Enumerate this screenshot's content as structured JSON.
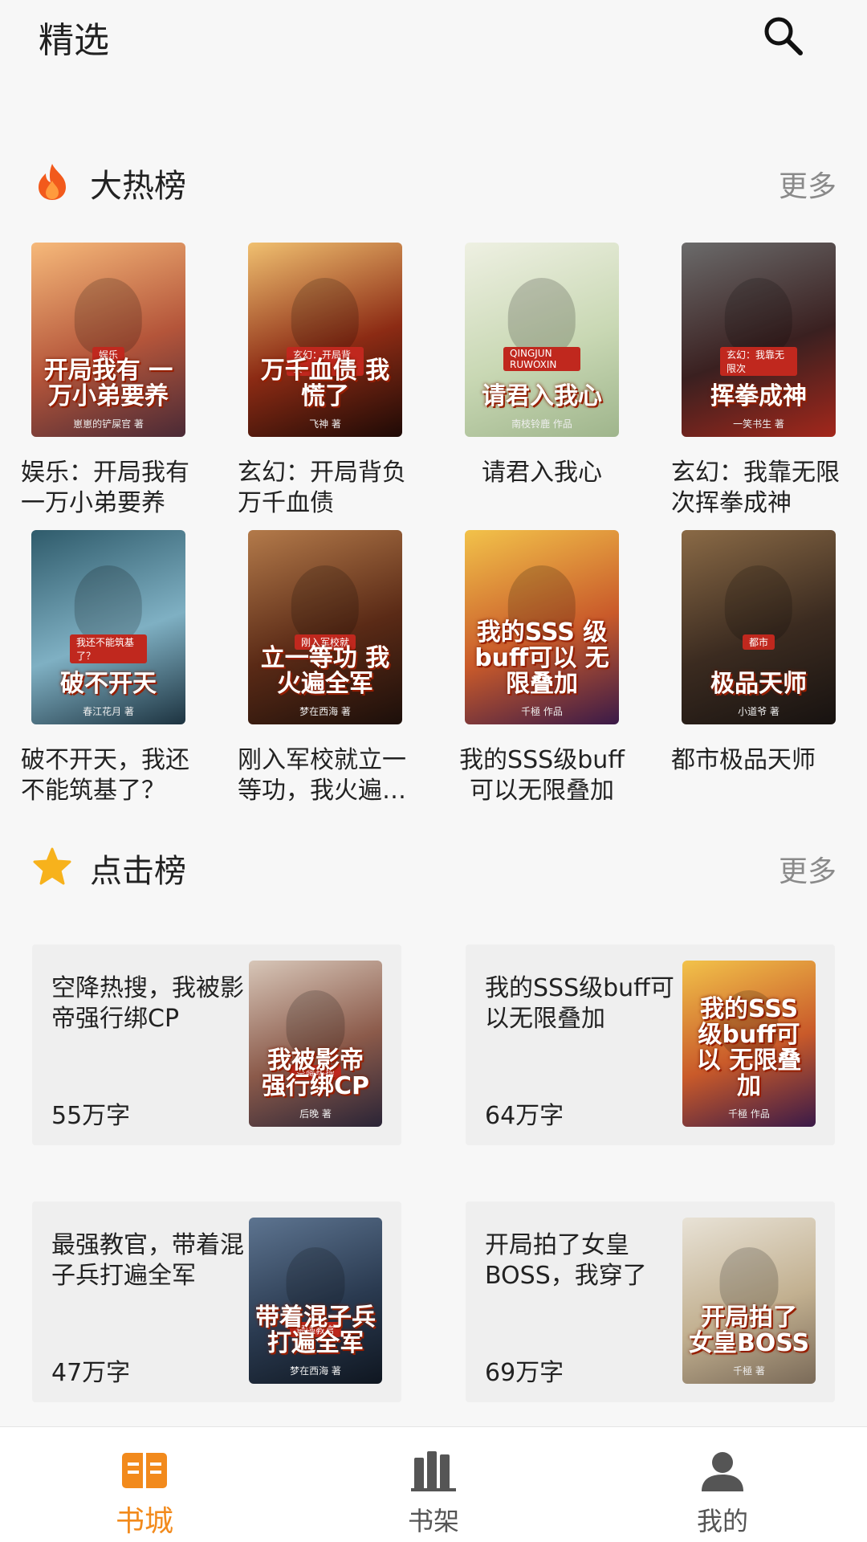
{
  "header": {
    "title": "精选",
    "search_icon": "search-icon"
  },
  "hot": {
    "title": "大热榜",
    "more": "更多",
    "icon": "flame-icon",
    "books": [
      {
        "title": "娱乐：开局我有一万小弟要养",
        "cover_text": "开局我有 一万小弟要养",
        "cover_tag": "娱乐",
        "cover_author": "崽崽的铲屎官 著",
        "colors": [
          "#f6b97a",
          "#b4553a",
          "#4a2a36"
        ]
      },
      {
        "title": "玄幻：开局背负万千血债",
        "cover_text": "万千血债 我慌了",
        "cover_tag": "玄幻：开局背负",
        "cover_author": "飞神 著",
        "colors": [
          "#f0c070",
          "#8c2b14",
          "#1e0a06"
        ]
      },
      {
        "title": "请君入我心",
        "cover_text": "请君入我心",
        "cover_tag": "QINGJUN RUWOXIN",
        "cover_author": "南枝铃鹿 作品",
        "colors": [
          "#eef0e2",
          "#c9d8b4",
          "#9fb58c"
        ]
      },
      {
        "title": "玄幻：我靠无限次挥拳成神",
        "cover_text": "挥拳成神",
        "cover_tag": "玄幻：我靠无限次",
        "cover_author": "一笑书生 著",
        "colors": [
          "#6b6b6b",
          "#3a2020",
          "#a3271b"
        ]
      },
      {
        "title": "破不开天，我还不能筑基了？",
        "cover_text": "破不开天",
        "cover_tag": "我还不能筑基了？",
        "cover_author": "春江花月 著",
        "colors": [
          "#2f5b6b",
          "#7fb0c3",
          "#1d3340"
        ]
      },
      {
        "title": "刚入军校就立一等功，我火遍全军",
        "cover_text": "立一等功 我火遍全军",
        "cover_tag": "刚入军校就",
        "cover_author": "梦在西海 著",
        "colors": [
          "#b37a4a",
          "#5a2a16",
          "#1c0f0a"
        ]
      },
      {
        "title": "我的SSS级buff可以无限叠加",
        "cover_text": "我的SSS 级buff可以 无限叠加",
        "cover_tag": "",
        "cover_author": "千極 作品",
        "colors": [
          "#f2c24a",
          "#c95a2a",
          "#3a1a48"
        ]
      },
      {
        "title": "都市极品天师",
        "cover_text": "极品天师",
        "cover_tag": "都市",
        "cover_author": "小道爷 著",
        "colors": [
          "#8a6a46",
          "#3b2b20",
          "#171210"
        ]
      }
    ]
  },
  "click": {
    "title": "点击榜",
    "more": "更多",
    "icon": "star-icon",
    "books": [
      {
        "title": "空降热搜，我被影帝强行绑CP",
        "count": "55万字",
        "cover_text": "我被影帝 强行绑CP",
        "cover_tag": "空降热搜",
        "cover_author": "后晚 著",
        "colors": [
          "#d7c6b8",
          "#8b5a4a",
          "#2a2436"
        ]
      },
      {
        "title": "我的SSS级buff可以无限叠加",
        "count": "64万字",
        "cover_text": "我的SSS 级buff可以 无限叠加",
        "cover_tag": "",
        "cover_author": "千極 作品",
        "colors": [
          "#f2c24a",
          "#c95a2a",
          "#3a1a48"
        ]
      },
      {
        "title": "最强教官，带着混子兵打遍全军",
        "count": "47万字",
        "cover_text": "带着混子兵 打遍全军",
        "cover_tag": "最强教官",
        "cover_author": "梦在西海 著",
        "colors": [
          "#5d7490",
          "#2a3a50",
          "#0f1620"
        ]
      },
      {
        "title": "开局拍了女皇BOSS，我穿了",
        "count": "69万字",
        "cover_text": "开局拍了 女皇BOSS",
        "cover_tag": "",
        "cover_author": "千極 著",
        "colors": [
          "#e8e2d6",
          "#c2b090",
          "#7a6a58"
        ]
      }
    ]
  },
  "nav": [
    {
      "label": "书城",
      "icon": "open-book-icon",
      "active": true
    },
    {
      "label": "书架",
      "icon": "bookshelf-icon",
      "active": false
    },
    {
      "label": "我的",
      "icon": "user-icon",
      "active": false
    }
  ],
  "colors": {
    "accent": "#f28a1c",
    "flame": "#f25a1c",
    "star": "#f7b21c",
    "muted": "#8a8a8a"
  }
}
